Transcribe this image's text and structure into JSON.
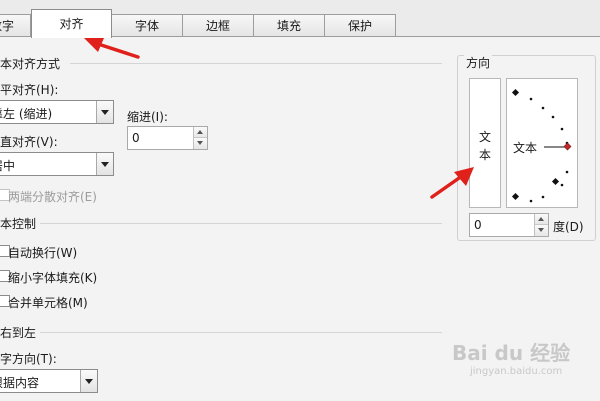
{
  "tabs": [
    {
      "label": "数字"
    },
    {
      "label": "对齐"
    },
    {
      "label": "字体"
    },
    {
      "label": "边框"
    },
    {
      "label": "填充"
    },
    {
      "label": "保护"
    }
  ],
  "alignment": {
    "group_title": "文本对齐方式",
    "horizontal_label": "水平对齐(H):",
    "horizontal_value": "靠左 (缩进)",
    "vertical_label": "垂直对齐(V):",
    "vertical_value": "居中",
    "indent_label": "缩进(I):",
    "indent_value": "0",
    "justify_distributed": "两端分散对齐(E)"
  },
  "text_control": {
    "group_title": "文本控制",
    "wrap": "自动换行(W)",
    "shrink": "缩小字体填充(K)",
    "merge": "合并单元格(M)"
  },
  "rtl": {
    "group_title": "从右到左",
    "direction_label": "文字方向(T):",
    "direction_value": "根据内容"
  },
  "orientation": {
    "title": "方向",
    "vertical_text": [
      "文",
      "本"
    ],
    "dial_text": "文本",
    "degrees_value": "0",
    "degrees_label": "度(D)"
  },
  "colors": {
    "annotation_arrow": "#e0211b",
    "dial_pointer": "#c0282d"
  },
  "watermark": {
    "brand": "Bai du 经验",
    "url": "jingyan.baidu.com"
  }
}
